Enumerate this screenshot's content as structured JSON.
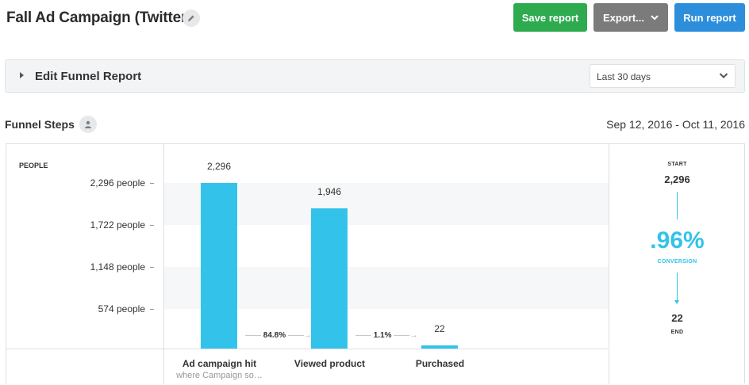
{
  "header": {
    "title": "Fall Ad Campaign (Twitter)",
    "edit_icon": "pencil-icon",
    "save_label": "Save report",
    "export_label": "Export...",
    "run_label": "Run report"
  },
  "edit_panel": {
    "label": "Edit Funnel Report",
    "range_value": "Last 30 days"
  },
  "funnel": {
    "section_title": "Funnel Steps",
    "person_icon": "person-icon",
    "date_range": "Sep 12, 2016 - Oct 11, 2016",
    "y_title": "PEOPLE",
    "ticks": [
      "2,296 people",
      "1,722 people",
      "1,148 people",
      "574 people"
    ],
    "summary": {
      "start_caption": "START",
      "start_value": "2,296",
      "conversion_pct": ".96%",
      "conversion_caption": "CONVERSION",
      "end_value": "22",
      "end_caption": "END"
    }
  },
  "chart_data": {
    "type": "bar",
    "categories": [
      "Ad campaign hit",
      "Viewed product",
      "Purchased"
    ],
    "values": [
      2296,
      1946,
      22
    ],
    "value_labels": [
      "2,296",
      "1,946",
      "22"
    ],
    "step_conversion": [
      "84.8%",
      "1.1%"
    ],
    "step_subtitles": [
      "where Campaign so…",
      "",
      ""
    ],
    "ylabel": "PEOPLE",
    "ylim": [
      0,
      2296
    ],
    "yticks": [
      574,
      1148,
      1722,
      2296
    ],
    "color": "#33c3ea"
  },
  "colors": {
    "save": "#2eaa4f",
    "export": "#7b7b7b",
    "run": "#2d8fdb",
    "accent": "#33c3ea"
  }
}
